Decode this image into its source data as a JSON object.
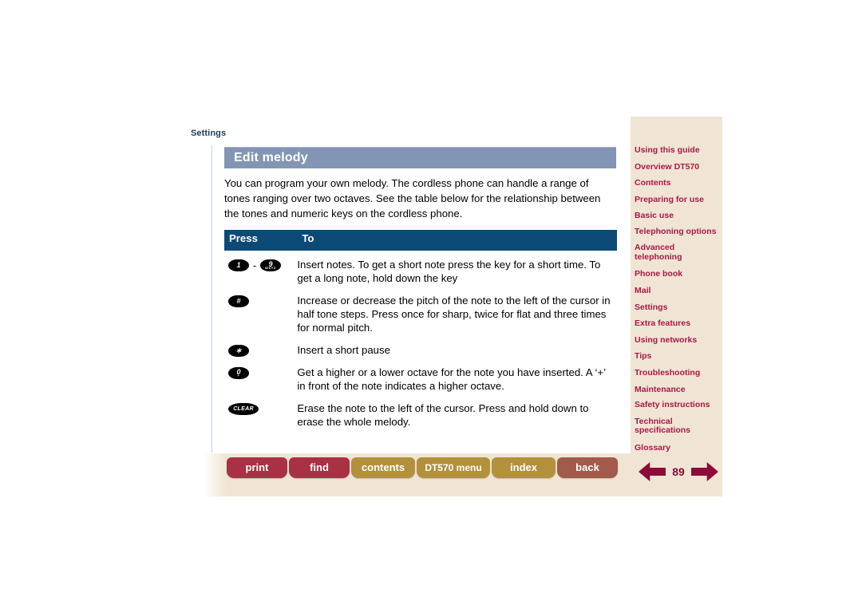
{
  "breadcrumb": "Settings",
  "page": {
    "title": "Edit melody",
    "intro": "You can program your own melody. The cordless phone can handle a range of tones ranging over two octaves. See the table below for the relationship between the tones and numeric keys on the cordless phone.",
    "number": "89"
  },
  "table": {
    "headers": {
      "press": "Press",
      "to": "To"
    },
    "rows": [
      {
        "keys": [
          {
            "type": "num",
            "digit": "1",
            "letters": ""
          },
          {
            "type": "dash",
            "digit": "-",
            "letters": ""
          },
          {
            "type": "num",
            "digit": "9",
            "letters": "WXYZ"
          }
        ],
        "desc": "Insert notes. To get a short note press the key for a short time. To get a long note, hold down the key"
      },
      {
        "keys": [
          {
            "type": "sym",
            "digit": "#",
            "letters": ""
          }
        ],
        "desc": "Increase or decrease the pitch of the note to the left of the cursor in half tone steps. Press once for sharp, twice for flat and three times for normal pitch."
      },
      {
        "keys": [
          {
            "type": "sym",
            "digit": "∗",
            "letters": ""
          }
        ],
        "desc": "Insert a short pause"
      },
      {
        "keys": [
          {
            "type": "num",
            "digit": "0",
            "letters": "+"
          }
        ],
        "desc": "Get a higher or a lower octave for the note you have inserted. A ‘+’ in front of the note indicates a higher octave."
      },
      {
        "keys": [
          {
            "type": "clear",
            "digit": "CLEAR",
            "letters": ""
          }
        ],
        "desc": "Erase the note to the left of the cursor. Press and hold down to erase the whole melody."
      }
    ]
  },
  "sidebar": {
    "items": [
      {
        "label": "Using this guide"
      },
      {
        "label": "Overview DT570"
      },
      {
        "label": "Contents"
      },
      {
        "label": "Preparing for use"
      },
      {
        "label": "Basic use"
      },
      {
        "label": "Telephoning options"
      },
      {
        "label": "Advanced telephoning"
      },
      {
        "label": "Phone book"
      },
      {
        "label": "Mail"
      },
      {
        "label": "Settings"
      },
      {
        "label": "Extra features"
      },
      {
        "label": "Using networks"
      },
      {
        "label": "Tips"
      },
      {
        "label": "Troubleshooting"
      },
      {
        "label": "Maintenance"
      },
      {
        "label": "Safety instructions"
      },
      {
        "label": "Technical specifications"
      },
      {
        "label": "Glossary"
      }
    ]
  },
  "bottom_nav": {
    "print": "print",
    "find": "find",
    "contents": "contents",
    "dt570_menu": "DT570 menu",
    "index": "index",
    "back": "back"
  },
  "colors": {
    "title_bar": "#8295b4",
    "table_header": "#0b4a77",
    "sidebar_bg": "#f0e5d4",
    "sidebar_link": "#a8184a",
    "btn_red": "#a93144",
    "btn_gold": "#b3903c",
    "btn_back": "#a25a4b",
    "arrow": "#8c0b38",
    "border_teal": "#b9d4dc"
  }
}
